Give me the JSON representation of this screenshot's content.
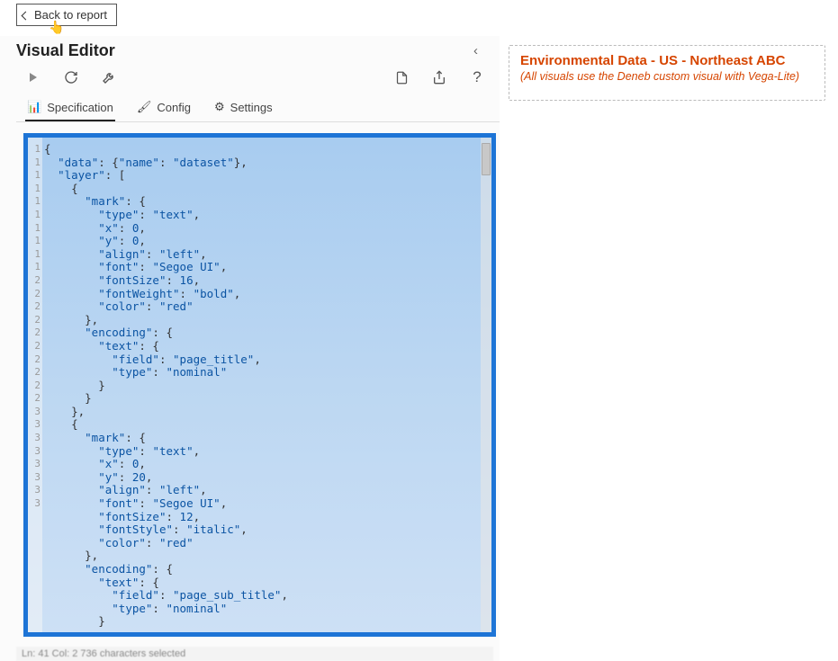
{
  "header": {
    "back_label": "Back to report",
    "panel_title": "Visual Editor"
  },
  "toolbar": {
    "play": "play-icon",
    "refresh": "refresh-icon",
    "repair": "wrench-icon",
    "new": "new-file-icon",
    "export": "export-icon",
    "help": "help-icon"
  },
  "tabs": [
    {
      "icon": "📊",
      "label": "Specification",
      "active": true
    },
    {
      "icon": "🖌",
      "label": "Config",
      "active": false
    },
    {
      "icon": "⚙",
      "label": "Settings",
      "active": false
    }
  ],
  "editor": {
    "selected": true,
    "gutter_visible_first_digit": [
      "",
      "",
      "",
      "",
      "",
      "",
      "",
      "",
      "",
      "1",
      "1",
      "1",
      "1",
      "1",
      "1",
      "1",
      "1",
      "1",
      "1",
      "2",
      "2",
      "2",
      "2",
      "2",
      "2",
      "2",
      "2",
      "2",
      "2",
      "3",
      "3",
      "3",
      "3",
      "3",
      "3",
      "3",
      "3"
    ],
    "code": "{\n  \"data\": {\"name\": \"dataset\"},\n  \"layer\": [\n    {\n      \"mark\": {\n        \"type\": \"text\",\n        \"x\": 0,\n        \"y\": 0,\n        \"align\": \"left\",\n        \"font\": \"Segoe UI\",\n        \"fontSize\": 16,\n        \"fontWeight\": \"bold\",\n        \"color\": \"red\"\n      },\n      \"encoding\": {\n        \"text\": {\n          \"field\": \"page_title\",\n          \"type\": \"nominal\"\n        }\n      }\n    },\n    {\n      \"mark\": {\n        \"type\": \"text\",\n        \"x\": 0,\n        \"y\": 20,\n        \"align\": \"left\",\n        \"font\": \"Segoe UI\",\n        \"fontSize\": 12,\n        \"fontStyle\": \"italic\",\n        \"color\": \"red\"\n      },\n      \"encoding\": {\n        \"text\": {\n          \"field\": \"page_sub_title\",\n          \"type\": \"nominal\"\n        }"
  },
  "status_bar": {
    "text": "Ln: 41   Col: 2   736 characters selected"
  },
  "visual": {
    "title": "Environmental Data - US - Northeast ABC",
    "subtitle": "(All visuals use the Deneb custom visual with Vega-Lite)"
  }
}
